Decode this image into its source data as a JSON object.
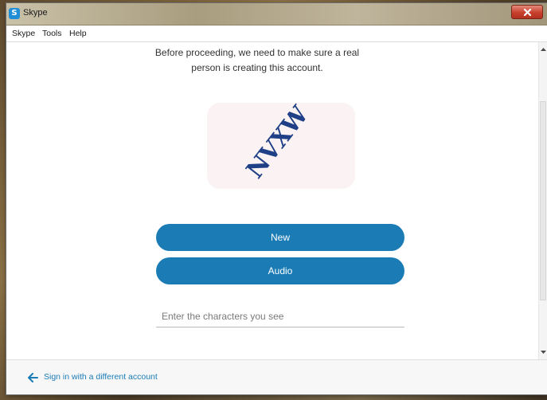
{
  "window": {
    "title": "Skype",
    "app_icon_letter": "S"
  },
  "menu": {
    "items": [
      "Skype",
      "Tools",
      "Help"
    ]
  },
  "main": {
    "prompt_line1": "Before proceeding, we need to make sure a real",
    "prompt_line2": "person is creating this account.",
    "captcha_text": "NVXW",
    "new_button_label": "New",
    "audio_button_label": "Audio",
    "input_placeholder": "Enter the characters you see",
    "input_value": ""
  },
  "footer": {
    "back_link_label": "Sign in with a different account"
  },
  "colors": {
    "accent": "#1b7cb5",
    "captcha_text": "#1f3f86",
    "captcha_bg": "#fbf3f3"
  },
  "icons": [
    "skype-logo-icon",
    "close-icon",
    "scroll-up-arrow-icon",
    "scroll-down-arrow-icon",
    "arrow-left-icon"
  ]
}
